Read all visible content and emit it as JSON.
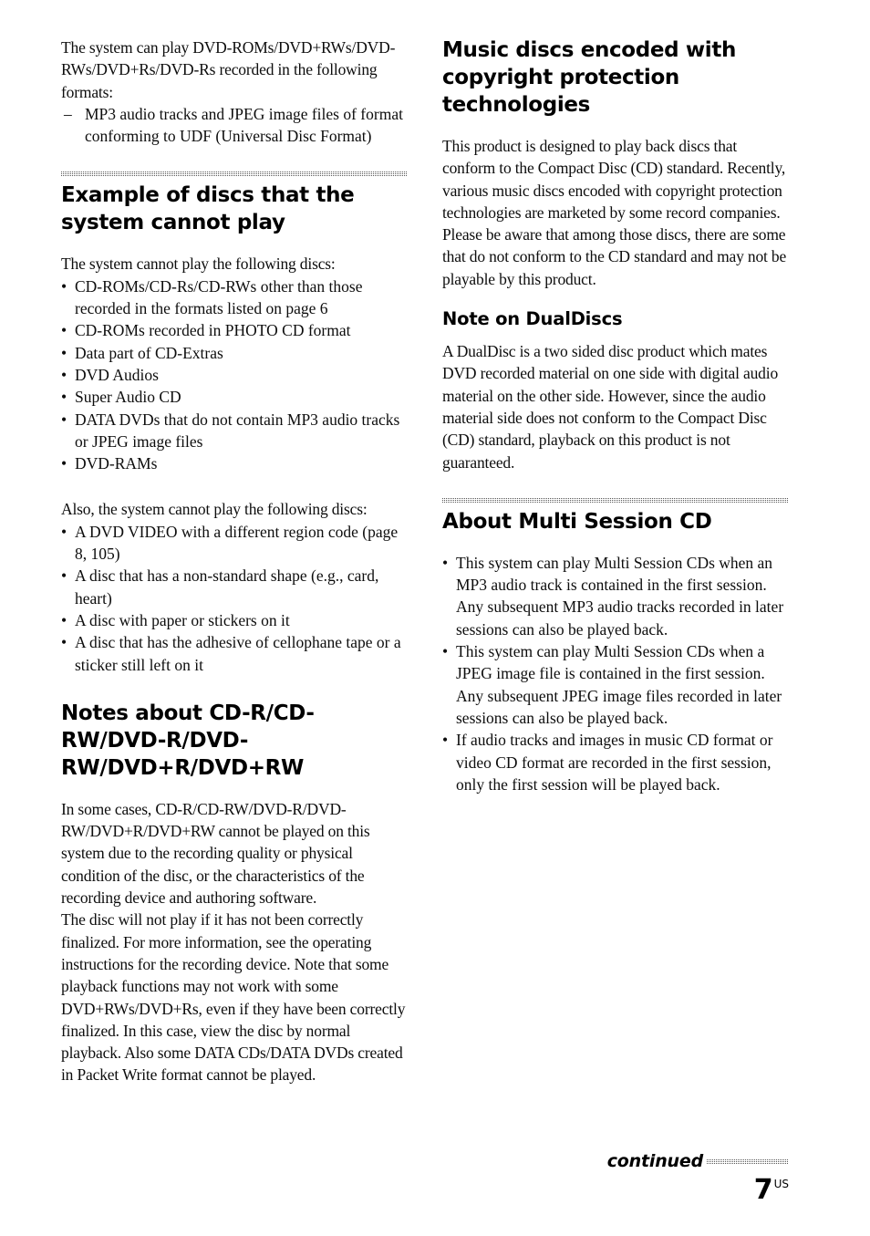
{
  "document": {
    "page_number": "7",
    "page_region_suffix": "US",
    "continued_label": "continued"
  },
  "left_column": {
    "intro_paragraph": "The system can play DVD-ROMs/DVD+RWs/DVD-RWs/DVD+Rs/DVD-Rs recorded in the following formats:",
    "intro_dash_items": [
      "MP3 audio tracks and JPEG image files of format conforming to UDF (Universal Disc Format)"
    ],
    "section_cannot_play": {
      "heading": "Example of discs that the system cannot play",
      "lead_paragraph": "The system cannot play the following discs:",
      "bullets": [
        "CD-ROMs/CD-Rs/CD-RWs other than those recorded in the formats listed on page 6",
        "CD-ROMs recorded in PHOTO CD format",
        "Data part of CD-Extras",
        "DVD Audios",
        "Super Audio CD",
        "DATA DVDs that do not contain MP3 audio tracks or JPEG image files",
        "DVD-RAMs"
      ],
      "second_lead_paragraph": "Also, the system cannot play the following discs:",
      "second_bullets": [
        "A DVD VIDEO with a different region code (page 8, 105)",
        "A disc that has a non-standard shape (e.g., card, heart)",
        "A disc with paper or stickers on it",
        "A disc that has the adhesive of cellophane tape or a sticker still left on it"
      ]
    },
    "section_notes_recordable": {
      "heading": "Notes about CD-R/CD-RW/DVD-R/DVD-RW/DVD+R/DVD+RW",
      "paragraph_1": "In some cases, CD-R/CD-RW/DVD-R/DVD-RW/DVD+R/DVD+RW cannot be played on this system due to the recording quality or physical condition of the disc, or the characteristics of the recording device and authoring software.",
      "paragraph_2": "The disc will not play if it has not been correctly finalized. For more information, see the operating instructions for the recording device. Note that some playback functions may not work with some DVD+RWs/DVD+Rs, even if they have been correctly finalized. In this case, view the disc by normal playback. Also some DATA CDs/DATA DVDs created in Packet Write format cannot be played."
    }
  },
  "right_column": {
    "section_copyright": {
      "heading": "Music discs encoded with copyright protection technologies",
      "paragraph": "This product is designed to play back discs that conform to the Compact Disc (CD) standard. Recently, various music discs encoded with copyright protection technologies are marketed by some record companies. Please be aware that among those discs, there are some that do not conform to the CD standard and may not be playable by this product."
    },
    "section_dualdiscs": {
      "heading": "Note on DualDiscs",
      "paragraph": "A DualDisc is a two sided disc product which mates DVD recorded material on one side with digital audio material on the other side. However, since the audio material side does not conform to the Compact Disc (CD) standard, playback on this product is not guaranteed."
    },
    "section_multisession": {
      "heading": "About Multi Session CD",
      "bullets": [
        "This system can play Multi Session CDs when an MP3 audio track is contained in the first session. Any subsequent MP3 audio tracks recorded in later sessions can also be played back.",
        "This system can play Multi Session CDs when a JPEG image file is contained in the first session. Any subsequent JPEG image files recorded in later sessions can also be played back.",
        "If audio tracks and images in music CD format or video CD format are recorded in the first session, only the first session will be played back."
      ]
    }
  },
  "markers": {
    "bullet": "•",
    "dash": "–"
  }
}
